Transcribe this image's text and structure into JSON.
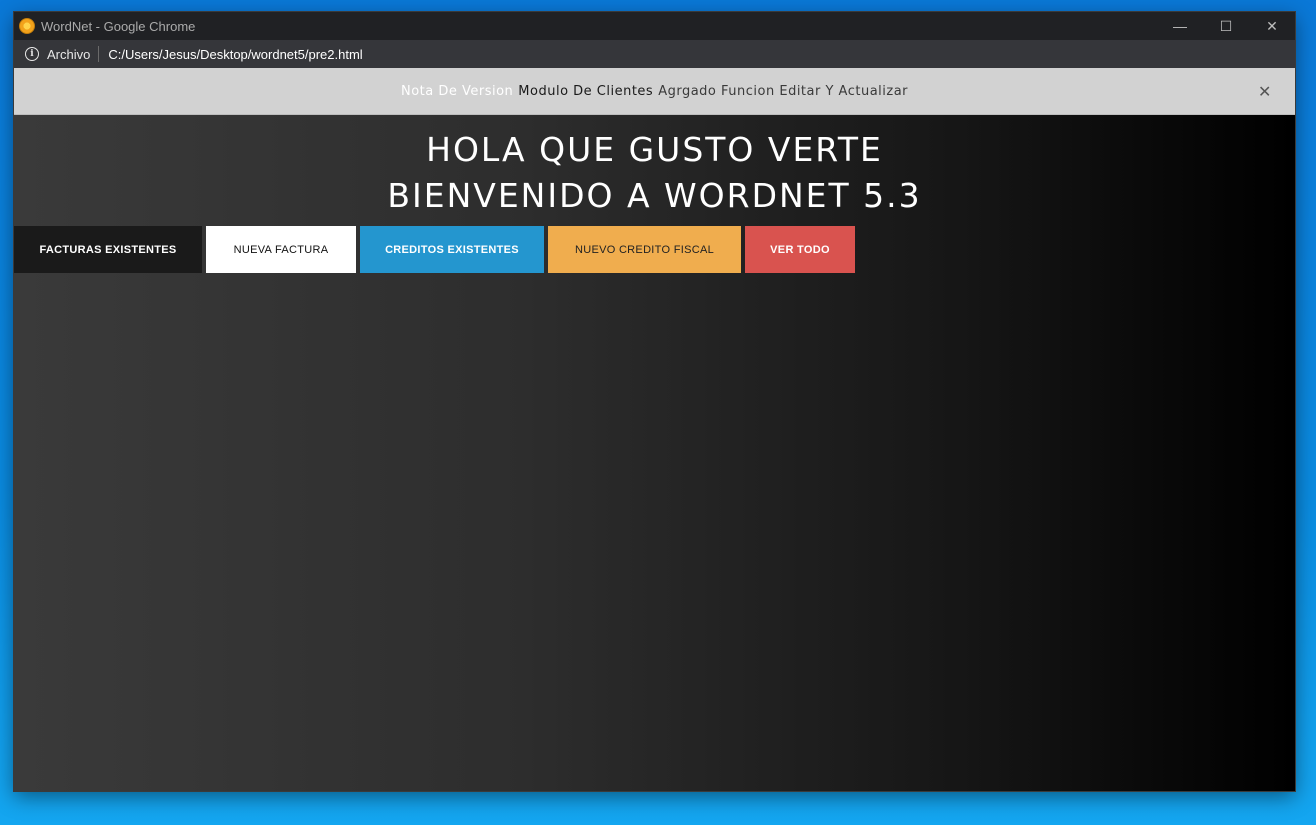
{
  "window": {
    "title": "WordNet - Google Chrome",
    "controls": {
      "minimize": "—",
      "maximize": "☐",
      "close": "✕"
    }
  },
  "addressbar": {
    "label": "Archivo",
    "url": "C:/Users/Jesus/Desktop/wordnet5/pre2.html"
  },
  "notice": {
    "prefix": "Nota De Version",
    "module": "Modulo De Clientes",
    "message": "Agrgado Funcion Editar Y Actualizar",
    "close": "✕"
  },
  "heading": {
    "line1": "HOLA QUE GUSTO VERTE",
    "line2": "BIENVENIDO A WORDNET 5.3"
  },
  "buttons": [
    {
      "label": "FACTURAS EXISTENTES",
      "color": "#1a1a1a"
    },
    {
      "label": "NUEVA FACTURA",
      "color": "#ffffff"
    },
    {
      "label": "CREDITOS EXISTENTES",
      "color": "#2496cf"
    },
    {
      "label": "NUEVO CREDITO FISCAL",
      "color": "#f0ad4e"
    },
    {
      "label": "VER TODO",
      "color": "#d9534f"
    }
  ]
}
